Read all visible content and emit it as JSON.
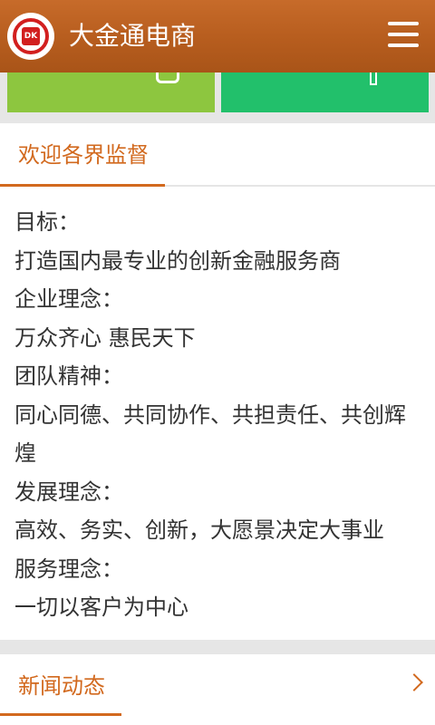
{
  "header": {
    "logo_text": "DK",
    "title": "大金通电商",
    "menu_icon": "hamburger-menu-icon"
  },
  "about": {
    "title": "欢迎各界监督",
    "lines": [
      "目标：",
      "打造国内最专业的创新金融服务商",
      "企业理念：",
      "万众齐心 惠民天下",
      "团队精神：",
      "同心同德、共同协作、共担责任、共创辉煌",
      "发展理念：",
      "高效、务实、创新，大愿景决定大事业",
      "服务理念：",
      "一切以客户为中心"
    ]
  },
  "news": {
    "title": "新闻动态"
  },
  "colors": {
    "header": "#b85e1f",
    "accent": "#d2691e",
    "tile_left": "#8dc63f",
    "tile_right": "#22c06b"
  }
}
